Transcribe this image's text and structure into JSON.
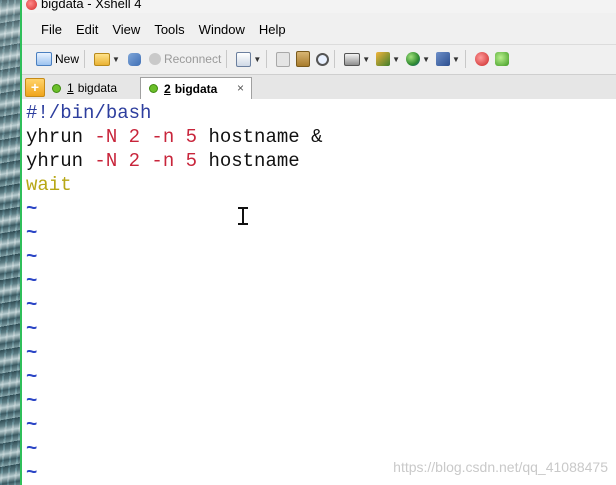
{
  "window": {
    "title": "bigdata - Xshell 4"
  },
  "menu": [
    "File",
    "Edit",
    "View",
    "Tools",
    "Window",
    "Help"
  ],
  "toolbar": {
    "new_label": "New",
    "reconnect_label": "Reconnect"
  },
  "tabs": [
    {
      "number": "1",
      "label": "bigdata",
      "active": false
    },
    {
      "number": "2",
      "label": "bigdata",
      "active": true
    }
  ],
  "tab_close": "×",
  "editor": {
    "lines": [
      [
        {
          "text": "#!/bin/bash",
          "color": "blue"
        }
      ],
      [
        {
          "text": "yhrun ",
          "color": "black"
        },
        {
          "text": "-N 2 -n 5",
          "color": "red"
        },
        {
          "text": " hostname &",
          "color": "black"
        }
      ],
      [
        {
          "text": "yhrun ",
          "color": "black"
        },
        {
          "text": "-N 2 -n 5",
          "color": "red"
        },
        {
          "text": " hostname",
          "color": "black"
        }
      ],
      [
        {
          "text": "wait",
          "color": "olive"
        }
      ]
    ],
    "tilde_count": 12,
    "tilde_char": "~"
  },
  "watermark": "https://blog.csdn.net/qq_41088475",
  "colors": {
    "blue": "#2d3e9e",
    "black": "#111111",
    "red": "#c8253b",
    "olive": "#b7a716",
    "tilde": "#2b45c5"
  }
}
